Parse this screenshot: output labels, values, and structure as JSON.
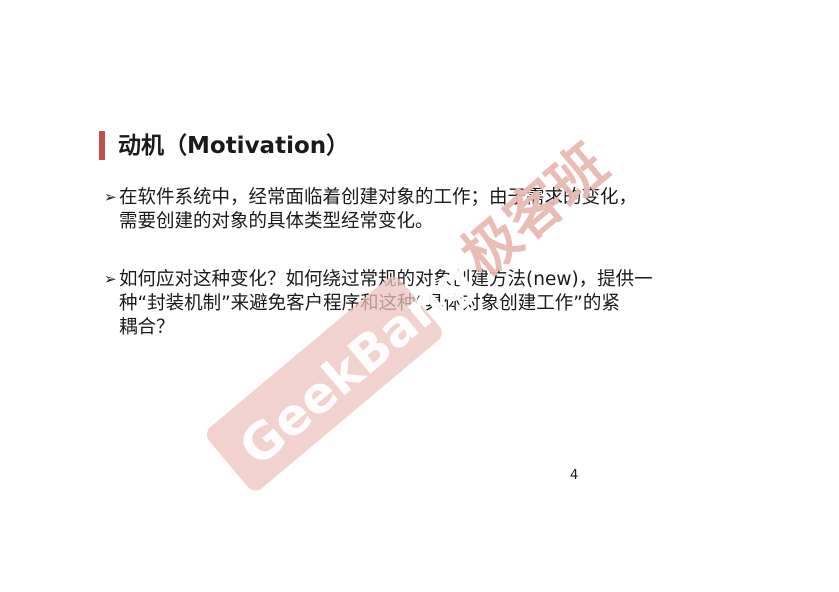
{
  "slide": {
    "title": "动机（Motivation）",
    "bullets": [
      {
        "marker": "➢",
        "lines": [
          "在软件系统中，经常面临着创建对象的工作；由于需求的变化，",
          "需要创建的对象的具体类型经常变化。"
        ]
      },
      {
        "marker": "➢",
        "lines": [
          "如何应对这种变化？如何绕过常规的对象创建方法(new)，提供一",
          "种“封装机制”来避免客户程序和这种“具体对象创建工作”的紧",
          "耦合？"
        ]
      }
    ],
    "page_number": "4"
  },
  "watermark": {
    "text": "GeekBang极客班"
  },
  "colors": {
    "accent": "#c0504d",
    "watermark": "#e8b8b2"
  }
}
